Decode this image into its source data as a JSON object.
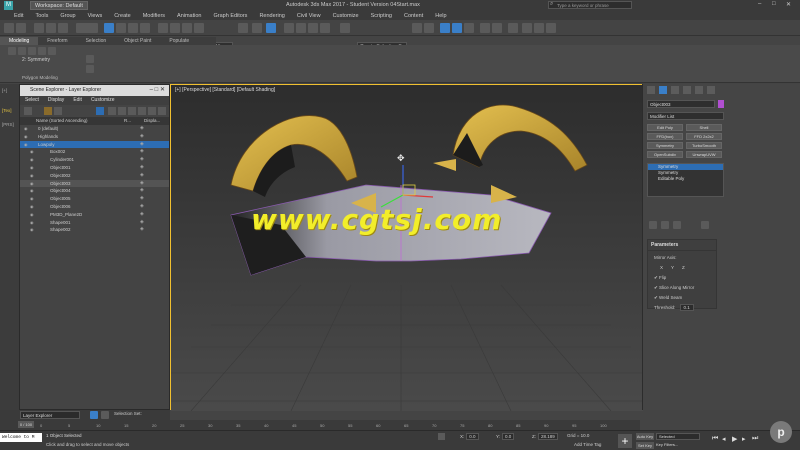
{
  "titlebar": {
    "workspace_label": "Workspace: Default",
    "app_title": "Autodesk 3ds Max 2017 - Student Version   04Start.max",
    "search_placeholder": "Type a keyword or phrase"
  },
  "menu": [
    "Edit",
    "Tools",
    "Group",
    "Views",
    "Create",
    "Modifiers",
    "Animation",
    "Graph Editors",
    "Rendering",
    "Civil View",
    "Customize",
    "Scripting",
    "Content",
    "Help"
  ],
  "toolbar": {
    "view_dropdown": "View",
    "selection_set": "Create Selection Se"
  },
  "ribbon": {
    "tabs": [
      "Modeling",
      "Freeform",
      "Selection",
      "Object Paint",
      "Populate"
    ],
    "active_tab": "Modeling",
    "symmetry_label": "2: Symmetry",
    "panel_label": "Polygon Modeling"
  },
  "leftstrip": {
    "labels": [
      "[+]",
      "[Tex]",
      "[PRS]"
    ]
  },
  "explorer": {
    "title": "Scene Explorer - Layer Explorer",
    "menu": [
      "Select",
      "Display",
      "Edit",
      "Customize"
    ],
    "columns": [
      "Name (Sorted Ascending)",
      "R...",
      "Displa..."
    ],
    "rows": [
      {
        "name": "0 (default)",
        "indent": 1,
        "state": "normal"
      },
      {
        "name": "Highlands",
        "indent": 1,
        "state": "normal"
      },
      {
        "name": "Lowpoly",
        "indent": 1,
        "state": "hl"
      },
      {
        "name": "Box002",
        "indent": 3,
        "state": "normal"
      },
      {
        "name": "Cylinder001",
        "indent": 3,
        "state": "normal"
      },
      {
        "name": "Object001",
        "indent": 3,
        "state": "normal"
      },
      {
        "name": "Object002",
        "indent": 3,
        "state": "normal"
      },
      {
        "name": "Object003",
        "indent": 3,
        "state": "sel"
      },
      {
        "name": "Object004",
        "indent": 3,
        "state": "normal"
      },
      {
        "name": "Object005",
        "indent": 3,
        "state": "normal"
      },
      {
        "name": "Object006",
        "indent": 3,
        "state": "normal"
      },
      {
        "name": "PM3D_Plane2D",
        "indent": 3,
        "state": "normal"
      },
      {
        "name": "Shape001",
        "indent": 3,
        "state": "normal"
      },
      {
        "name": "Shape002",
        "indent": 3,
        "state": "normal"
      }
    ],
    "footer_label": "Layer Explorer",
    "footer_selset": "Selection Set:"
  },
  "viewport": {
    "label": "[+] [Perspective] [Standard] [Default Shading]",
    "watermark": "www.cgtsj.com"
  },
  "command_panel": {
    "object_name": "Object003",
    "object_color": "#b04fd0",
    "modifier_list": "Modifier List",
    "buttons": [
      "Edit Poly",
      "Shell",
      "FFD(box)",
      "FFD 2x2x2",
      "Symmetry",
      "TurboSmooth",
      "OpenSubdiv",
      "UnwrapUVW"
    ],
    "stack": [
      {
        "label": "Symmetry",
        "selected": true
      },
      {
        "label": "Symmetry",
        "selected": false
      },
      {
        "label": "Editable Poly",
        "selected": false
      }
    ],
    "params": {
      "title": "Parameters",
      "mirror_axis": "Mirror Axis:",
      "axes": [
        "X",
        "Y",
        "Z"
      ],
      "flip": "Flip",
      "slice": "Slice Along Mirror",
      "weld": "Weld Seam",
      "threshold_label": "Threshold:",
      "threshold_value": "0.1"
    }
  },
  "timeline": {
    "frame": "0 / 100",
    "ticks": [
      "0",
      "5",
      "10",
      "15",
      "20",
      "25",
      "30",
      "35",
      "40",
      "45",
      "50",
      "55",
      "60",
      "65",
      "70",
      "75",
      "80",
      "85",
      "90",
      "95",
      "100"
    ]
  },
  "status": {
    "welcome": "Welcome to M",
    "selected": "1 Object Selected",
    "hint": "Click and drag to select and move objects",
    "x_label": "X:",
    "x_value": "0.0",
    "y_label": "Y:",
    "y_value": "0.0",
    "z_label": "Z:",
    "z_value": "28.189",
    "grid": "Grid = 10.0",
    "add_time_tag": "Add Time Tag",
    "auto_key": "Auto Key",
    "set_key": "Set Key",
    "selected_dropdown": "Selected",
    "key_filters": "Key Filters..."
  },
  "badge": "p"
}
